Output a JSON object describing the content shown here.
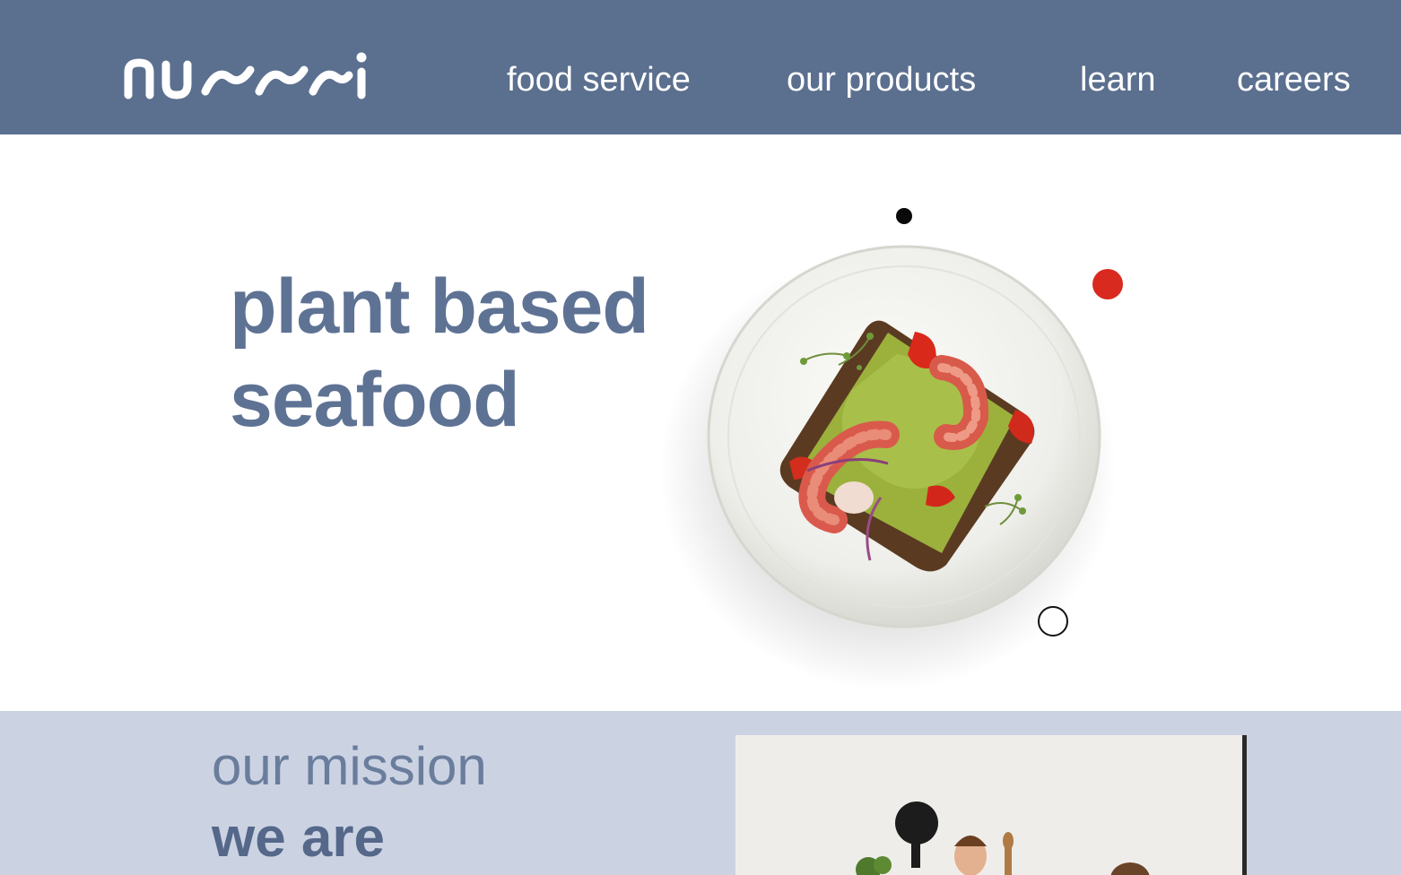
{
  "brand": {
    "logo_text": "nuumi"
  },
  "nav": {
    "items": [
      {
        "label": "food service"
      },
      {
        "label": "our products"
      },
      {
        "label": "learn"
      },
      {
        "label": "careers"
      }
    ]
  },
  "hero": {
    "title_line1": "plant based",
    "title_line2": "seafood"
  },
  "mission": {
    "kicker": "our mission",
    "heading": "we are"
  },
  "colors": {
    "header_bg": "#5b6f8f",
    "hero_text": "#5e7294",
    "accent_red": "#d92a1f",
    "mission_bg": "#cbd3e3"
  }
}
